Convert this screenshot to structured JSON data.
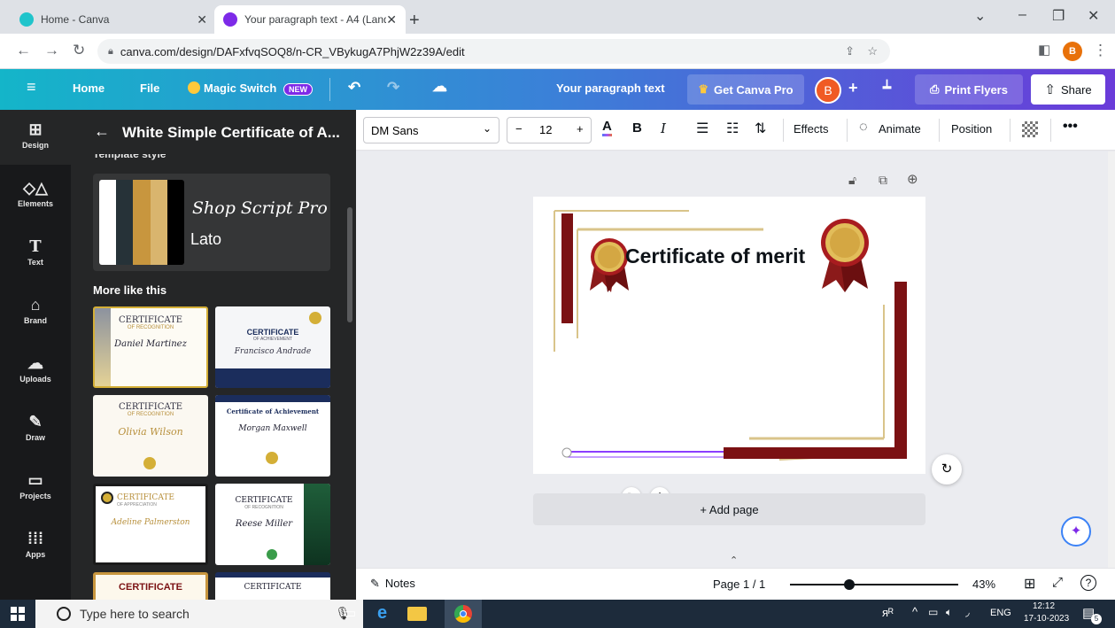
{
  "browser": {
    "tabs": [
      {
        "title": "Home - Canva"
      },
      {
        "title": "Your paragraph text - A4 (Landsc"
      }
    ],
    "url": "canva.com/design/DAFxfvqSOQ8/n-CR_VBykugA7PhjW2z39A/edit",
    "colors": {
      "tabstrip": "#dee1e6",
      "avatar": "#e8710a"
    }
  },
  "header": {
    "home": "Home",
    "file": "File",
    "magic_switch": "Magic Switch",
    "new_badge": "NEW",
    "doc_title": "Your paragraph text",
    "get_pro": "Get Canva Pro",
    "avatar_letter": "B",
    "print": "Print Flyers",
    "share": "Share"
  },
  "rail": {
    "items": [
      {
        "label": "Design",
        "icon": "layout-icon"
      },
      {
        "label": "Elements",
        "icon": "shapes-icon"
      },
      {
        "label": "Text",
        "icon": "text-icon"
      },
      {
        "label": "Brand",
        "icon": "brand-icon"
      },
      {
        "label": "Uploads",
        "icon": "upload-icon"
      },
      {
        "label": "Draw",
        "icon": "draw-icon"
      },
      {
        "label": "Projects",
        "icon": "folder-icon"
      },
      {
        "label": "Apps",
        "icon": "apps-icon"
      }
    ]
  },
  "panel": {
    "title": "White Simple Certificate of A...",
    "section_partial": "Template style",
    "style_font_script": "Shop Script Pro",
    "style_font_body": "Lato",
    "palette": [
      "#ffffff",
      "#263238",
      "#c8963e",
      "#d9b56e",
      "#000000"
    ],
    "more_like_this": "More like this",
    "thumbs": [
      {
        "title": "CERTIFICATE",
        "sub": "OF RECOGNITION",
        "name": "Daniel Martinez"
      },
      {
        "title": "CERTIFICATE",
        "sub": "OF ACHIEVEMENT",
        "name": "Francisco Andrade"
      },
      {
        "title": "CERTIFICATE",
        "sub": "OF RECOGNITION",
        "name": "Olivia Wilson"
      },
      {
        "title": "Certificate of Achievement",
        "sub": "",
        "name": "Morgan Maxwell"
      },
      {
        "title": "CERTIFICATE",
        "sub": "OF APPRECIATION",
        "name": "Adeline Palmerston"
      },
      {
        "title": "CERTIFICATE",
        "sub": "OF RECOGNITION",
        "name": "Reese Miller"
      },
      {
        "title": "CERTIFICATE",
        "sub": "",
        "name": ""
      },
      {
        "title": "CERTIFICATE",
        "sub": "",
        "name": ""
      }
    ]
  },
  "toolbar": {
    "font": "DM Sans",
    "font_size": "12",
    "effects": "Effects",
    "animate": "Animate",
    "position": "Position"
  },
  "canvas": {
    "certificate_title": "Certificate of merit",
    "add_page": "+ Add page",
    "colors": {
      "maroon": "#7b1113",
      "gold": "#d9c48a",
      "seal": "#d4a743"
    }
  },
  "bottom": {
    "notes": "Notes",
    "page_indicator": "Page 1 / 1",
    "zoom": "43%",
    "zoom_fraction": 0.43
  },
  "taskbar": {
    "search_placeholder": "Type here to search",
    "lang": "ENG",
    "time": "12:12",
    "date": "17-10-2023",
    "notif_count": "5"
  }
}
